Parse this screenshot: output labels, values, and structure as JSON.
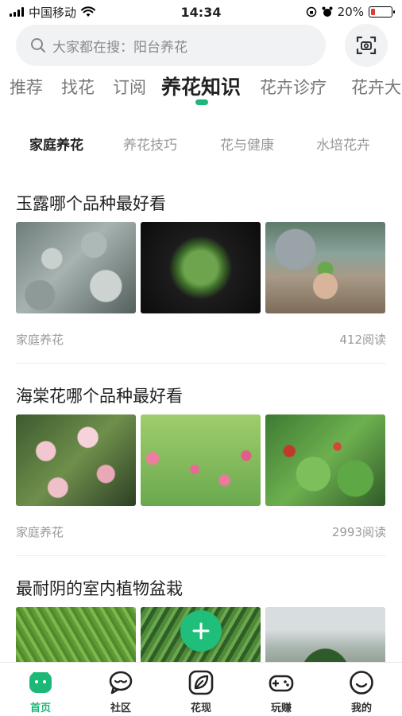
{
  "status_bar": {
    "carrier": "中国移动",
    "time": "14:34",
    "battery_percent": "20%",
    "battery_level": 0.2,
    "icons": [
      "signal-icon",
      "wifi-icon",
      "rotation-lock-icon",
      "alarm-icon",
      "battery-icon"
    ]
  },
  "search": {
    "placeholder": "大家都在搜：阳台养花",
    "scan_icon": "scan-camera-icon"
  },
  "top_tabs": [
    {
      "label": "推荐"
    },
    {
      "label": "找花"
    },
    {
      "label": "订阅"
    },
    {
      "label": "养花知识",
      "active": true
    },
    {
      "label": "花卉诊疗"
    },
    {
      "label": "花卉大"
    }
  ],
  "sub_tabs": [
    {
      "label": "家庭养花",
      "active": true
    },
    {
      "label": "养花技巧"
    },
    {
      "label": "花与健康"
    },
    {
      "label": "水培花卉"
    }
  ],
  "articles": [
    {
      "title": "玉露哪个品种最好看",
      "category": "家庭养花",
      "reads": "412阅读"
    },
    {
      "title": "海棠花哪个品种最好看",
      "category": "家庭养花",
      "reads": "2993阅读"
    },
    {
      "title": "最耐阴的室内植物盆栽"
    }
  ],
  "fab": {
    "icon": "plus-icon"
  },
  "bottom_nav": [
    {
      "label": "首页",
      "icon": "home-icon",
      "active": true
    },
    {
      "label": "社区",
      "icon": "chat-icon"
    },
    {
      "label": "花现",
      "icon": "leaf-icon"
    },
    {
      "label": "玩赚",
      "icon": "gamepad-icon"
    },
    {
      "label": "我的",
      "icon": "smiley-icon"
    }
  ],
  "colors": {
    "accent": "#1cb877",
    "battery_low": "#e53935",
    "search_bg": "#f1f2f4"
  }
}
